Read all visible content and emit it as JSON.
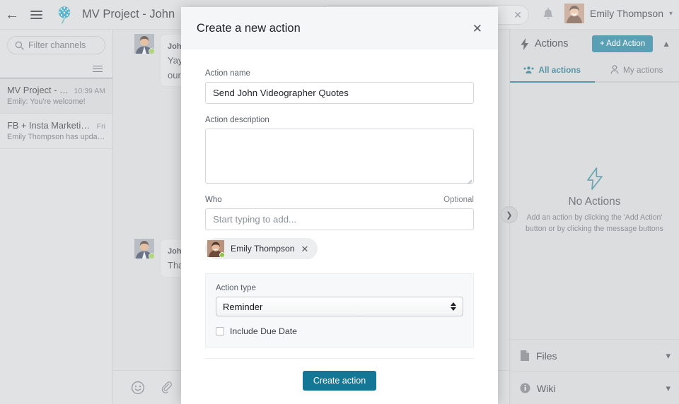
{
  "header": {
    "back_icon": "back-arrow-icon",
    "menu_icon": "hamburger-menu-icon",
    "logo_icon": "dandelion-logo-icon",
    "project_title": "MV Project - John",
    "search_clear_icon": "close-icon",
    "bell_icon": "notification-bell-icon",
    "user_name": "Emily Thompson",
    "user_caret_icon": "chevron-down-icon"
  },
  "sidebar": {
    "filter_placeholder": "Filter channels",
    "search_icon": "search-icon",
    "list_menu_icon": "list-options-icon",
    "channels": [
      {
        "name": "MV Project - John",
        "time": "10:39 AM",
        "preview": "Emily: You're welcome!",
        "active": true
      },
      {
        "name": "FB + Insta Marketing - ...",
        "time": "Fri",
        "preview": "Emily Thompson has updated re...",
        "active": false
      }
    ]
  },
  "messages": [
    {
      "author": "John",
      "line1": "Yay",
      "line2": "our"
    },
    {
      "author": "John",
      "line1": "Tha",
      "line2": ""
    }
  ],
  "composer": {
    "emoji_icon": "emoji-icon",
    "attach_icon": "paperclip-icon"
  },
  "collapse_handle_icon": "chevron-right-icon",
  "right_panel": {
    "bolt_icon": "lightning-bolt-icon",
    "title": "Actions",
    "add_button_label": "+ Add Action",
    "collapse_icon": "chevron-up-icon",
    "tabs": [
      {
        "label": "All actions",
        "icon": "people-group-icon",
        "selected": true
      },
      {
        "label": "My actions",
        "icon": "person-icon",
        "selected": false
      }
    ],
    "empty_icon": "lightning-bolt-outline-icon",
    "empty_title": "No Actions",
    "empty_subtitle": "Add an action by clicking the 'Add Action' button or by clicking the message buttons",
    "sections": [
      {
        "label": "Files",
        "icon": "file-icon",
        "chevron": "chevron-down-icon"
      },
      {
        "label": "Wiki",
        "icon": "info-circle-icon",
        "chevron": "chevron-down-icon"
      }
    ]
  },
  "modal": {
    "title": "Create a new action",
    "close_icon": "close-icon",
    "action_name_label": "Action name",
    "action_name_value": "Send John Videographer Quotes",
    "action_description_label": "Action description",
    "action_description_value": "",
    "who_label": "Who",
    "who_optional": "Optional",
    "who_placeholder": "Start typing to add...",
    "who_chips": [
      {
        "name": "Emily Thompson",
        "remove_icon": "close-icon"
      }
    ],
    "action_type_label": "Action type",
    "action_type_value": "Reminder",
    "action_type_options": [
      "Reminder"
    ],
    "include_due_date_label": "Include Due Date",
    "include_due_date_checked": false,
    "submit_label": "Create action"
  },
  "colors": {
    "accent": "#147796",
    "tab_active": "#13697f",
    "presence_online": "#8dc63f"
  }
}
